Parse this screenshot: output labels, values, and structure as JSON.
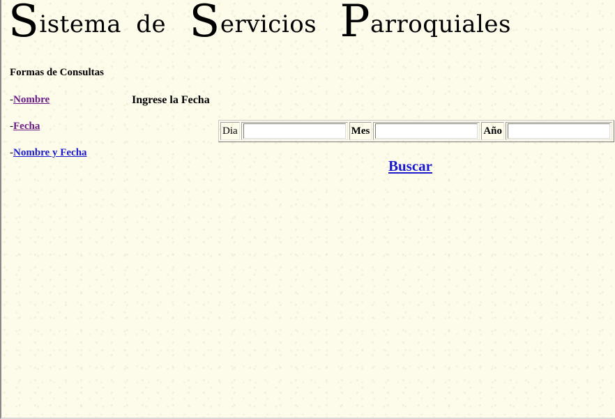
{
  "header": {
    "title_words": [
      {
        "cap": "S",
        "rest": "istema"
      },
      {
        "cap": "",
        "rest": "de"
      },
      {
        "cap": "S",
        "rest": "ervicios"
      },
      {
        "cap": "P",
        "rest": "arroquiales"
      }
    ]
  },
  "sidebar": {
    "heading": "Formas de Consultas",
    "items": [
      {
        "prefix": "-",
        "label": "Nombre",
        "visited": true
      },
      {
        "prefix": "-",
        "label": "Fecha",
        "visited": true
      },
      {
        "prefix": "-",
        "label": "Nombre y Fecha",
        "visited": false
      }
    ]
  },
  "form": {
    "heading": "Ingrese la Fecha",
    "fields": [
      {
        "label": "Dia",
        "value": ""
      },
      {
        "label": "Mes",
        "value": ""
      },
      {
        "label": "Año",
        "value": ""
      }
    ],
    "submit_label": "Buscar"
  },
  "colors": {
    "background": "#fdfbea",
    "link": "#1a1acc",
    "visited_link": "#6b1a86"
  }
}
